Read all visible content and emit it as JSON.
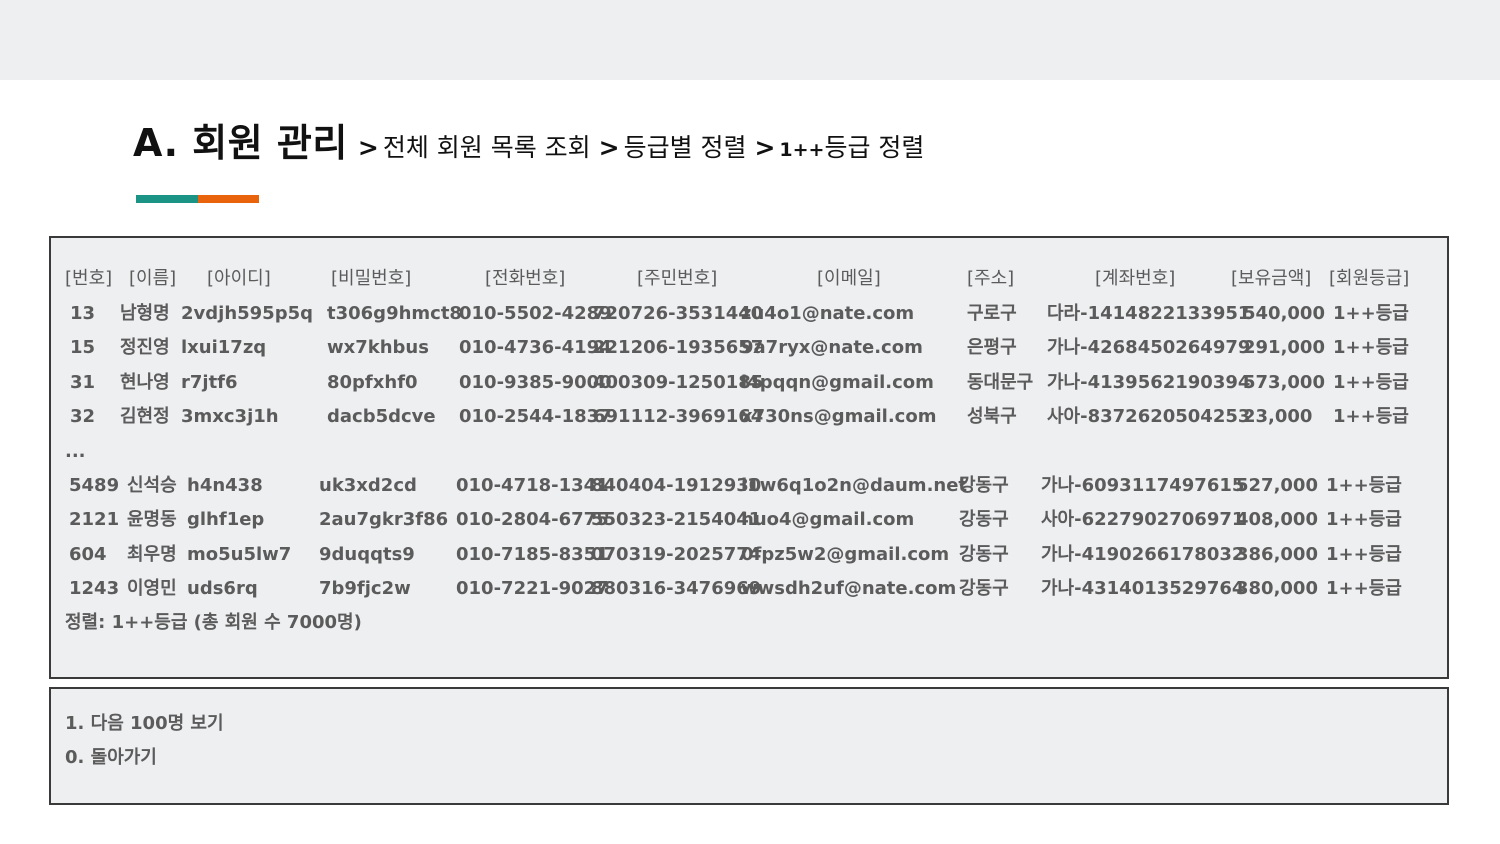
{
  "title": {
    "main": "A. 회원 관리",
    "path": [
      {
        "sep": ">",
        "label": "전체 회원 목록 조회"
      },
      {
        "sep": ">",
        "label": "등급별 정렬"
      },
      {
        "sep": ">",
        "grade": "1++",
        "label": "등급 정렬"
      }
    ]
  },
  "colors": {
    "band": "#eeeff1",
    "panel_bg": "#eeeff1",
    "border": "#3a3a3a",
    "accent_teal": "#1b9486",
    "accent_orange": "#e9630c",
    "text": "#5b5b5b"
  },
  "table": {
    "headers": [
      "[번호]",
      "[이름]",
      "[아이디]",
      "[비밀번호]",
      "[전화번호]",
      "[주민번호]",
      "[이메일]",
      "[주소]",
      "[계좌번호]",
      "[보유금액]",
      "[회원등급]"
    ],
    "rows_top": [
      [
        "13",
        "남형명",
        "2vdjh595p5q",
        "t306g9hmct8",
        "010-5502-4289",
        "720726-3531440",
        "zu4o1@nate.com",
        "구로구",
        "다라-1414822133951",
        "540,000",
        "1++등급"
      ],
      [
        "15",
        "정진영",
        "lxui17zq",
        "wx7khbus",
        "010-4736-4194",
        "221206-1935657",
        "9a7ryx@nate.com",
        "은평구",
        "가나-4268450264979",
        "291,000",
        "1++등급"
      ],
      [
        "31",
        "현나영",
        "r7jtf6",
        "80pfxhf0",
        "010-9385-9000",
        "400309-1250185",
        "l4pqqn@gmail.com",
        "동대문구",
        "가나-4139562190394",
        "573,000",
        "1++등급"
      ],
      [
        "32",
        "김현정",
        "3mxc3j1h",
        "dacb5dcve",
        "010-2544-1837",
        "691112-3969164",
        "x730ns@gmail.com",
        "성북구",
        "사아-8372620504253",
        "23,000",
        "1++등급"
      ]
    ],
    "ellipsis": "...",
    "rows_bottom": [
      [
        "5489",
        "신석승",
        "h4n438",
        "uk3xd2cd",
        "010-4718-1341",
        "840404-1912930",
        "i1w6q1o2n@daum.net",
        "강동구",
        "가나-6093117497615",
        "527,000",
        "1++등급"
      ],
      [
        "2121",
        "윤명동",
        "glhf1ep",
        "2au7gkr3f86",
        "010-2804-6775",
        "550323-2154041",
        "huo4@gmail.com",
        "강동구",
        "사아-6227902706971",
        "408,000",
        "1++등급"
      ],
      [
        "604",
        "최우명",
        "mo5u5lw7",
        "9duqqts9",
        "010-7185-8351",
        "070319-2025774",
        "0fpz5w2@gmail.com",
        "강동구",
        "가나-4190266178032",
        "386,000",
        "1++등급"
      ],
      [
        "1243",
        "이영민",
        "uds6rq",
        "7b9fjc2w",
        "010-7221-9027",
        "880316-3476969",
        "wwsdh2uf@nate.com",
        "강동구",
        "가나-4314013529764",
        "380,000",
        "1++등급"
      ]
    ],
    "footer": "정렬: 1++등급 (총 회원 수 7000명)"
  },
  "menu": [
    "1. 다음 100명 보기",
    "0. 돌아가기"
  ]
}
